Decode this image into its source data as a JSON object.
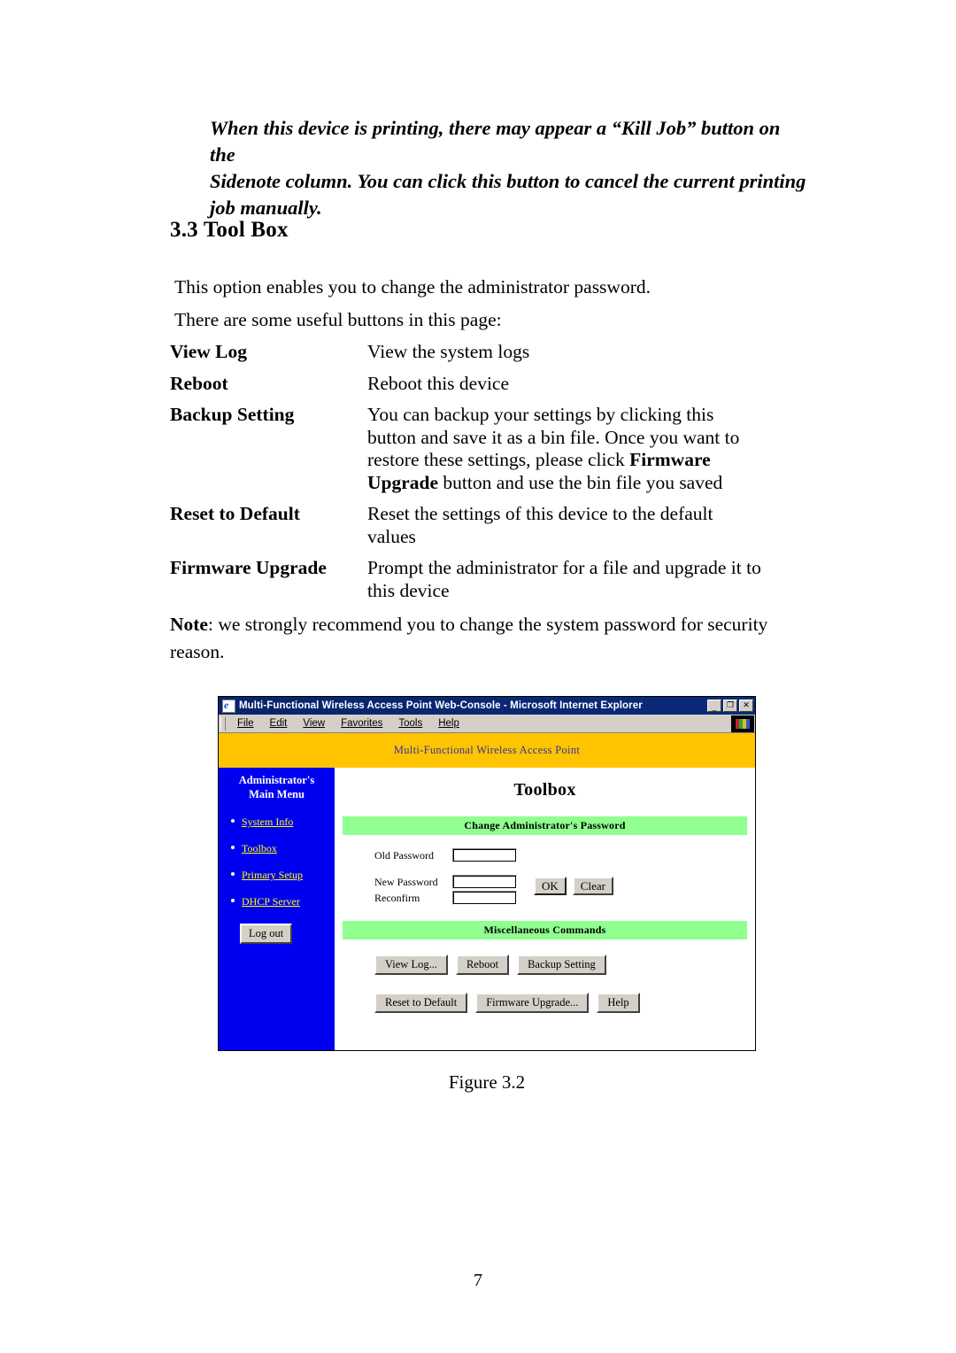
{
  "document": {
    "sidenote": {
      "lines": [
        "When this device is printing, there may appear a “Kill Job” button on the",
        "Sidenote column. You can click this button to cancel the current printing",
        "job manually."
      ]
    },
    "section_heading": "3.3 Tool Box",
    "intro_line_1": "This option enables you to change the administrator password.",
    "intro_line_2": "There are some useful buttons in this page:",
    "definitions": [
      {
        "term": "View Log",
        "lines": [
          "View the system logs"
        ]
      },
      {
        "term": "Reboot",
        "lines": [
          "Reboot this device"
        ]
      },
      {
        "term": "Backup Setting",
        "lines": [
          "You can backup your settings by clicking this",
          "button and save it as a bin file. Once you want to",
          "restore these settings, please click Firmware",
          "Upgrade button and use the bin file you saved"
        ]
      },
      {
        "term": "Reset to Default",
        "lines": [
          "Reset the settings of this device to the default",
          "values"
        ]
      },
      {
        "term": "Firmware Upgrade",
        "lines": [
          "Prompt the administrator for a file and upgrade it to",
          "this device"
        ]
      }
    ],
    "note": {
      "label": "Note",
      "line_1_rest": ": we strongly recommend you to change the system password for security",
      "line_2": "reason."
    },
    "figure_caption": "Figure 3.2",
    "page_number": "7"
  },
  "figure": {
    "browser": {
      "title": "Multi-Functional Wireless Access Point Web-Console - Microsoft Internet Explorer",
      "app_icon": "ie-document-icon",
      "window_buttons": {
        "minimize": "_",
        "maximize": "❐",
        "close": "✕"
      },
      "menu": [
        "File",
        "Edit",
        "View",
        "Favorites",
        "Tools",
        "Help"
      ]
    },
    "webpage": {
      "banner": "Multi-Functional Wireless Access Point",
      "sidebar": {
        "title_line_1": "Administrator's",
        "title_line_2": "Main Menu",
        "links": [
          "System Info",
          "Toolbox",
          "Primary Setup",
          "DHCP Server"
        ],
        "logout_button": "Log out"
      },
      "main": {
        "page_title": "Toolbox",
        "password_section_header": "Change Administrator's Password",
        "fields": [
          {
            "label": "Old Password",
            "value": ""
          },
          {
            "label": "New Password",
            "value": ""
          },
          {
            "label": "Reconfirm",
            "value": ""
          }
        ],
        "ok_button": "OK",
        "clear_button": "Clear",
        "misc_section_header": "Miscellaneous Commands",
        "buttons_row_1": [
          "View Log...",
          "Reboot",
          "Backup Setting"
        ],
        "buttons_row_2": [
          "Reset to Default",
          "Firmware Upgrade...",
          "Help"
        ]
      }
    },
    "colors": {
      "banner_yellow": "#ffc400",
      "sidebar_blue": "#0000f0",
      "sidebar_link_yellow": "#ffff00",
      "section_green": "#90ff90",
      "titlebar_blue": "#0a246a",
      "chrome_gray": "#d4d0c8"
    }
  }
}
